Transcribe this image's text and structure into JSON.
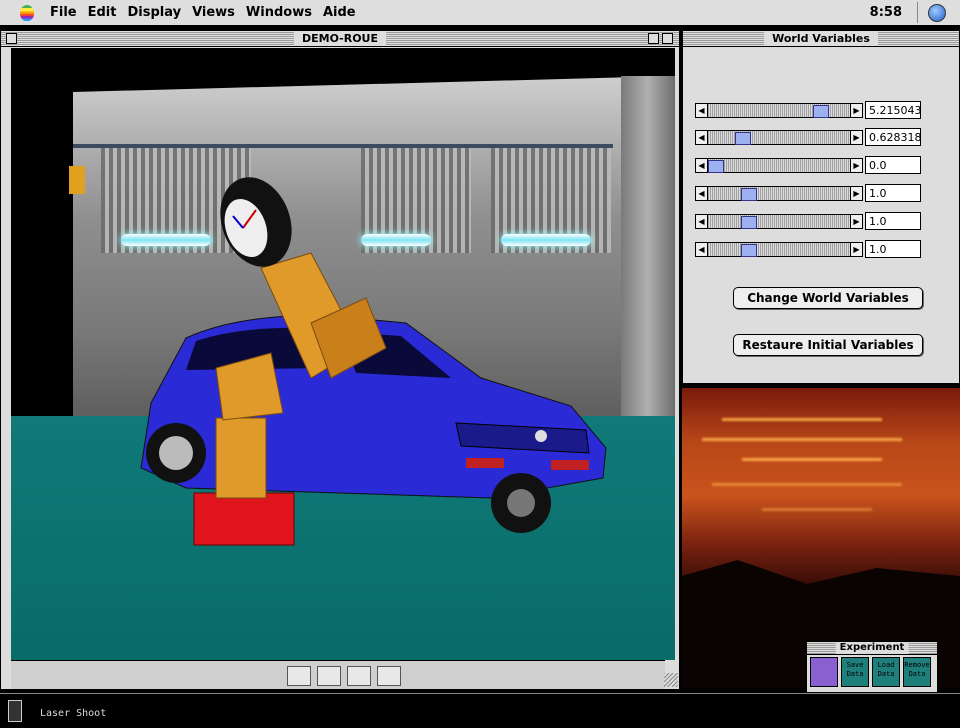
{
  "menubar": {
    "items": [
      "File",
      "Edit",
      "Display",
      "Views",
      "Windows",
      "Aide"
    ],
    "clock": "8:58"
  },
  "main_window": {
    "title": "DEMO-ROUE"
  },
  "world_variables": {
    "title": "World Variables",
    "sliders": [
      {
        "value": "5.2150438",
        "position": 0.82
      },
      {
        "value": "0.6283185",
        "position": 0.21
      },
      {
        "value": "0.0",
        "position": 0.0
      },
      {
        "value": "1.0",
        "position": 0.26
      },
      {
        "value": "1.0",
        "position": 0.26
      },
      {
        "value": "1.0",
        "position": 0.26
      }
    ],
    "change_button": "Change World Variables",
    "restore_button": "Restaure Initial Variables"
  },
  "experiment": {
    "title": "Experiment",
    "buttons": [
      {
        "label": ""
      },
      {
        "label": "Save Data"
      },
      {
        "label": "Load Data"
      },
      {
        "label": "Remove Data"
      }
    ]
  },
  "status": {
    "text": "Laser Shoot"
  },
  "colors": {
    "car": "#2a2ad6",
    "robot": "#e09a2a",
    "base": "#e0141c",
    "floor": "#0f7a78"
  }
}
